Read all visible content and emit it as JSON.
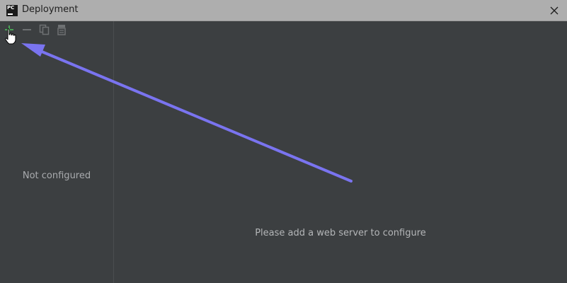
{
  "window": {
    "title": "Deployment",
    "logo_text": "PC"
  },
  "toolbar": {
    "icons": [
      "add-icon",
      "remove-icon",
      "copy-icon",
      "paste-icon"
    ]
  },
  "server_list": {
    "empty_text": "Not configured"
  },
  "details_panel": {
    "empty_text": "Please add a web server to configure"
  },
  "annotation": {
    "arrow_color": "#7a74f0"
  },
  "colors": {
    "background": "#3c3f41",
    "titlebar": "#aeaeae",
    "add_green": "#4aa356"
  }
}
